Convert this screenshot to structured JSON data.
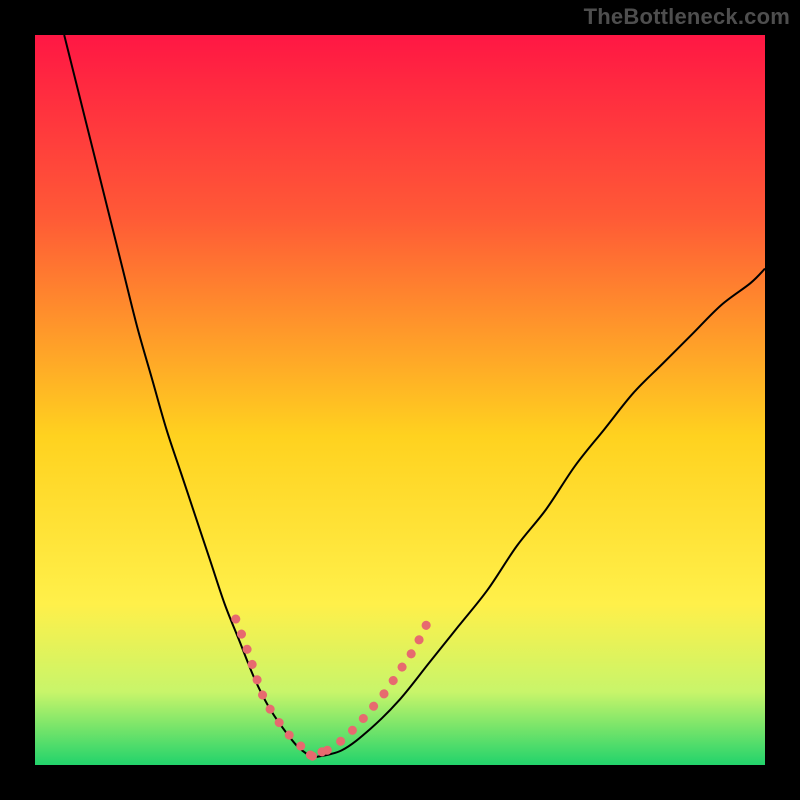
{
  "watermark": "TheBottleneck.com",
  "chart_data": {
    "type": "line",
    "title": "",
    "xlabel": "",
    "ylabel": "",
    "xlim": [
      0,
      100
    ],
    "ylim": [
      0,
      100
    ],
    "grid": false,
    "legend": false,
    "gradient_stops": [
      {
        "offset": 0,
        "color": "#ff1744"
      },
      {
        "offset": 25,
        "color": "#ff5a36"
      },
      {
        "offset": 55,
        "color": "#ffd21f"
      },
      {
        "offset": 78,
        "color": "#fff04a"
      },
      {
        "offset": 90,
        "color": "#c8f56a"
      },
      {
        "offset": 100,
        "color": "#22d36b"
      }
    ],
    "series": [
      {
        "name": "left-curve",
        "x": [
          4,
          6,
          8,
          10,
          12,
          14,
          16,
          18,
          20,
          22,
          24,
          26,
          28,
          30,
          32,
          34,
          36,
          38
        ],
        "y": [
          100,
          92,
          84,
          76,
          68,
          60,
          53,
          46,
          40,
          34,
          28,
          22,
          17,
          12,
          8,
          5,
          2.5,
          1
        ],
        "stroke": "#000000",
        "width": 2,
        "smooth": true
      },
      {
        "name": "right-curve",
        "x": [
          38,
          42,
          46,
          50,
          54,
          58,
          62,
          66,
          70,
          74,
          78,
          82,
          86,
          90,
          94,
          98,
          100
        ],
        "y": [
          1,
          2,
          5,
          9,
          14,
          19,
          24,
          30,
          35,
          41,
          46,
          51,
          55,
          59,
          63,
          66,
          68
        ],
        "stroke": "#000000",
        "width": 2,
        "smooth": true
      },
      {
        "name": "left-dots",
        "x": [
          27.5,
          29,
          30,
          31,
          32,
          32.8,
          33.6,
          34.3,
          35,
          35.7,
          36.4
        ],
        "y": [
          20,
          16,
          13,
          10,
          8,
          6.8,
          5.6,
          4.7,
          3.9,
          3.2,
          2.6
        ],
        "stroke": "#e76a6f",
        "width": 9,
        "linecap": "round",
        "dash": "0.1 16",
        "smooth": true
      },
      {
        "name": "right-dots",
        "x": [
          38,
          39,
          40,
          41.3,
          42.7,
          44.3,
          46,
          48,
          50,
          52,
          54
        ],
        "y": [
          1.2,
          1.5,
          2.0,
          2.8,
          4.0,
          5.6,
          7.6,
          10,
          13,
          16,
          20
        ],
        "stroke": "#e76a6f",
        "width": 9,
        "linecap": "round",
        "dash": "0.1 16",
        "smooth": true
      },
      {
        "name": "trough-dots",
        "x": [
          36.4,
          37.2,
          38,
          38.8,
          39.6
        ],
        "y": [
          2.6,
          1.9,
          1.2,
          1.5,
          2.0
        ],
        "stroke": "#e76a6f",
        "width": 9,
        "linecap": "round",
        "dash": "0.1 13",
        "smooth": true
      }
    ]
  }
}
